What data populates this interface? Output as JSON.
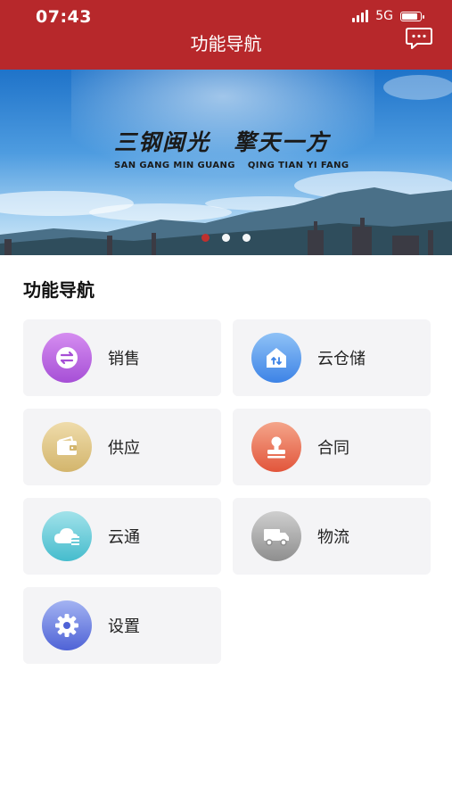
{
  "status_bar": {
    "time": "07:43",
    "network": "5G",
    "battery_percent": 85
  },
  "header": {
    "title": "功能导航",
    "message_icon": "chat-bubble-icon"
  },
  "banner": {
    "slogan_cn": [
      "三钢闽光",
      "擎天一方"
    ],
    "slogan_en": [
      "SAN GANG MIN GUANG",
      "QING TIAN YI FANG"
    ],
    "carousel": {
      "total": 3,
      "active_index": 0
    }
  },
  "section": {
    "title": "功能导航"
  },
  "menu": [
    {
      "label": "销售",
      "icon": "exchange-icon",
      "color_top": "#d58df0",
      "color_bottom": "#a64fd6"
    },
    {
      "label": "云仓储",
      "icon": "warehouse-icon",
      "color_top": "#8fc2f6",
      "color_bottom": "#3d83e6"
    },
    {
      "label": "供应",
      "icon": "wallet-icon",
      "color_top": "#efdcab",
      "color_bottom": "#d3b56c"
    },
    {
      "label": "合同",
      "icon": "stamp-icon",
      "color_top": "#f4a58a",
      "color_bottom": "#e2553b"
    },
    {
      "label": "云通",
      "icon": "cloud-list-icon",
      "color_top": "#a2e2ea",
      "color_bottom": "#45bccd"
    },
    {
      "label": "物流",
      "icon": "truck-icon",
      "color_top": "#cfcfcf",
      "color_bottom": "#8e8e8e"
    },
    {
      "label": "设置",
      "icon": "gear-icon",
      "color_top": "#a3b3f2",
      "color_bottom": "#4f63d6"
    }
  ]
}
